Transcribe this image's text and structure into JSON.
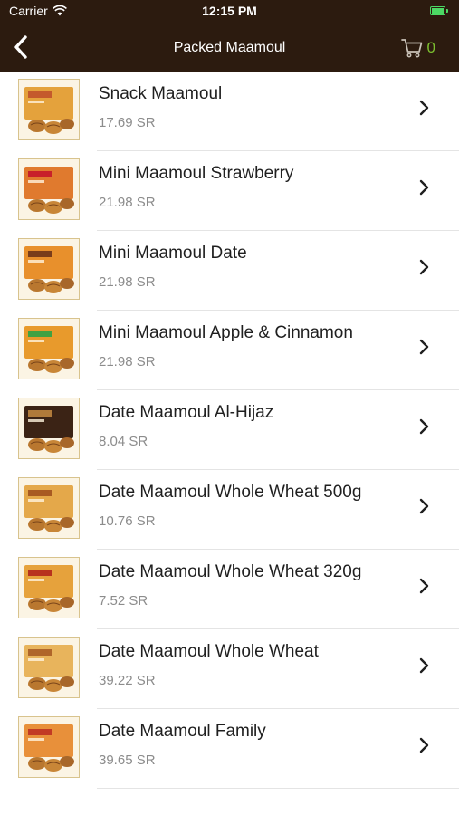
{
  "status_bar": {
    "carrier": "Carrier",
    "time": "12:15 PM"
  },
  "nav": {
    "title": "Packed Maamoul",
    "cart_count": "0"
  },
  "products": [
    {
      "name": "Snack Maamoul",
      "price": "17.69 SR",
      "box_color": "#e4a23c",
      "accent_color": "#c45a2c"
    },
    {
      "name": "Mini Maamoul Strawberry",
      "price": "21.98 SR",
      "box_color": "#e07a2e",
      "accent_color": "#c8202a"
    },
    {
      "name": "Mini Maamoul Date",
      "price": "21.98 SR",
      "box_color": "#e8902c",
      "accent_color": "#7a3d1a"
    },
    {
      "name": "Mini Maamoul Apple & Cinnamon",
      "price": "21.98 SR",
      "box_color": "#e89a2c",
      "accent_color": "#3fa142"
    },
    {
      "name": "Date Maamoul Al-Hijaz",
      "price": "8.04 SR",
      "box_color": "#3b2315",
      "accent_color": "#b07a3a"
    },
    {
      "name": "Date Maamoul Whole Wheat 500g",
      "price": "10.76 SR",
      "box_color": "#e4a84a",
      "accent_color": "#a85a22"
    },
    {
      "name": "Date Maamoul Whole Wheat 320g",
      "price": "7.52 SR",
      "box_color": "#e6a23c",
      "accent_color": "#b8321e"
    },
    {
      "name": "Date Maamoul Whole Wheat",
      "price": "39.22 SR",
      "box_color": "#e8b45c",
      "accent_color": "#b0662a"
    },
    {
      "name": "Date Maamoul Family",
      "price": "39.65 SR",
      "box_color": "#e8903a",
      "accent_color": "#c23a24"
    }
  ],
  "colors": {
    "header_bg": "#2c1b0f",
    "cart_accent": "#7cc02f",
    "battery": "#4cd964"
  },
  "icons": {
    "back": "chevron-left-icon",
    "cart": "shopping-cart-icon",
    "row_chevron": "chevron-right-icon",
    "wifi": "wifi-icon",
    "battery": "battery-icon"
  }
}
